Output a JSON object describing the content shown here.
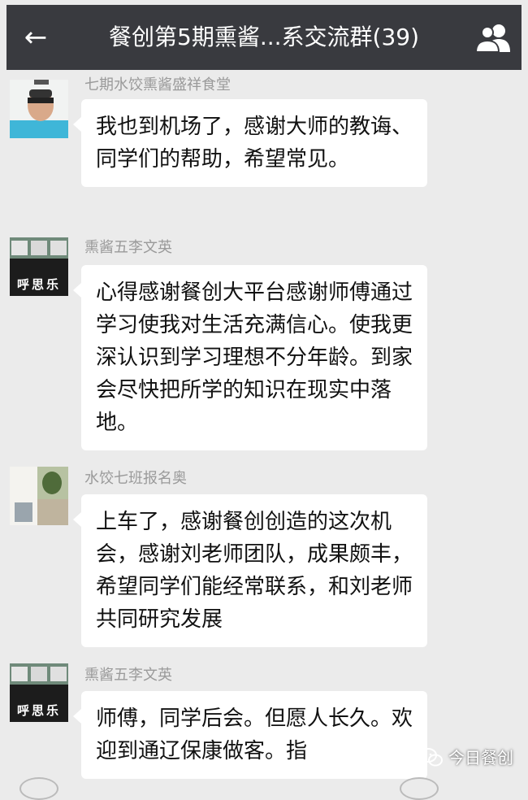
{
  "header": {
    "back_icon": "arrow-left-icon",
    "title": "餐创第5期熏酱...系交流群(39)",
    "members_icon": "group-members-icon"
  },
  "messages": [
    {
      "nickname": "七期水饺熏酱盛祥食堂",
      "text": "我也到机场了，感谢大师的教诲、同学们的帮助，希望常见。"
    },
    {
      "nickname": "熏酱五李文英",
      "avatar_text": "呼思乐",
      "text": "心得感谢餐创大平台感谢师傅通过学习使我对生活充满信心。使我更深认识到学习理想不分年龄。到家会尽快把所学的知识在现实中落地。"
    },
    {
      "nickname": "水饺七班报名奥",
      "text": "上车了，感谢餐创创造的这次机会，感谢刘老师团队，成果颇丰，希望同学们能经常联系，和刘老师共同研究发展"
    },
    {
      "nickname": "熏酱五李文英",
      "avatar_text": "呼思乐",
      "text": "师傅，同学后会。但愿人长久。欢迎到通辽保康做客。指"
    }
  ],
  "watermark": {
    "text": "今日餐创",
    "icon": "wechat-logo-icon"
  },
  "colors": {
    "header_bg": "#393a3f",
    "chat_bg": "#ebebeb",
    "bubble_bg": "#ffffff",
    "nickname": "#9a9a9a"
  }
}
